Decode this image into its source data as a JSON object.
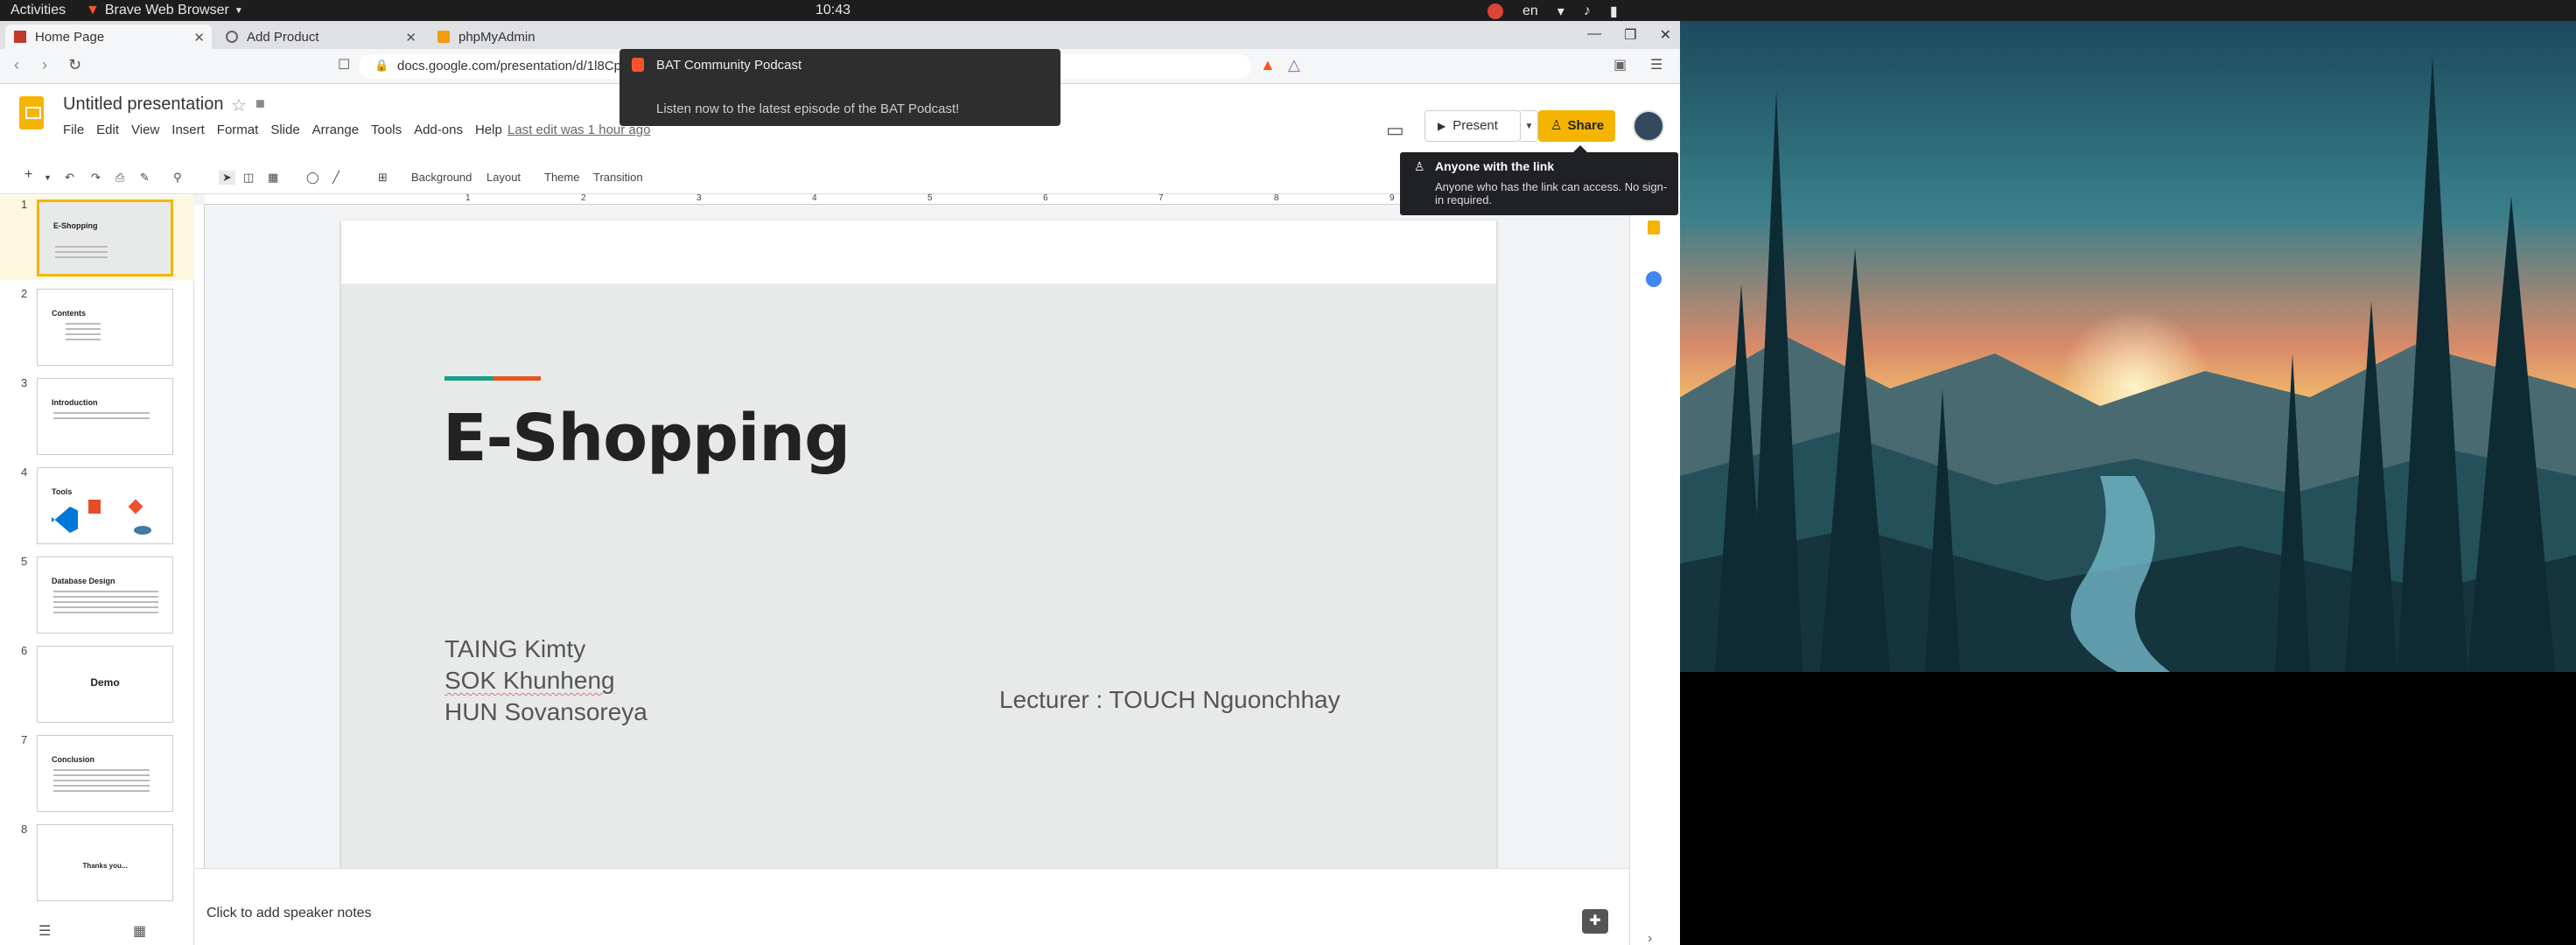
{
  "topbar": {
    "activities": "Activities",
    "app_menu": "Brave Web Browser",
    "clock": "10:43",
    "lang": "en"
  },
  "browser": {
    "tabs": [
      {
        "label": "Home Page"
      },
      {
        "label": "Add Product"
      },
      {
        "label": "phpMyAdmin"
      }
    ],
    "url": "docs.google.com/presentation/d/1l8Cpg"
  },
  "notification": {
    "title": "BAT Community Podcast",
    "body": "Listen now to the latest episode of the BAT Podcast!"
  },
  "slides_header": {
    "title": "Untitled presentation",
    "menus": [
      "File",
      "Edit",
      "View",
      "Insert",
      "Format",
      "Slide",
      "Arrange",
      "Tools",
      "Add-ons",
      "Help"
    ],
    "last_edit": "Last edit was 1 hour ago",
    "present_label": "Present",
    "share_label": "Share"
  },
  "share_tooltip": {
    "title": "Anyone with the link",
    "desc": "Anyone who has the link can access. No sign-in required."
  },
  "toolbar": {
    "background": "Background",
    "layout": "Layout",
    "theme": "Theme",
    "transition": "Transition"
  },
  "filmstrip": {
    "slides": [
      {
        "num": "1",
        "title": "E-Shopping"
      },
      {
        "num": "2",
        "title": "Contents"
      },
      {
        "num": "3",
        "title": "Introduction"
      },
      {
        "num": "4",
        "title": "Tools"
      },
      {
        "num": "5",
        "title": "Database Design"
      },
      {
        "num": "6",
        "title": "Demo"
      },
      {
        "num": "7",
        "title": "Conclusion"
      },
      {
        "num": "8",
        "title": "Thanks you..."
      }
    ]
  },
  "ruler": {
    "marks": [
      "1",
      "2",
      "3",
      "4",
      "5",
      "6",
      "7",
      "8",
      "9"
    ]
  },
  "slide": {
    "title": "E-Shopping",
    "authors": [
      "TAING Kimty",
      "SOK Khunheng",
      "HUN Sovansoreya"
    ],
    "lecturer": "Lecturer : TOUCH Nguonchhay"
  },
  "notes": {
    "placeholder": "Click to add speaker notes"
  },
  "colors": {
    "accent_green": "#16a085",
    "accent_orange": "#e8551e",
    "slides_yellow": "#f4b400"
  }
}
